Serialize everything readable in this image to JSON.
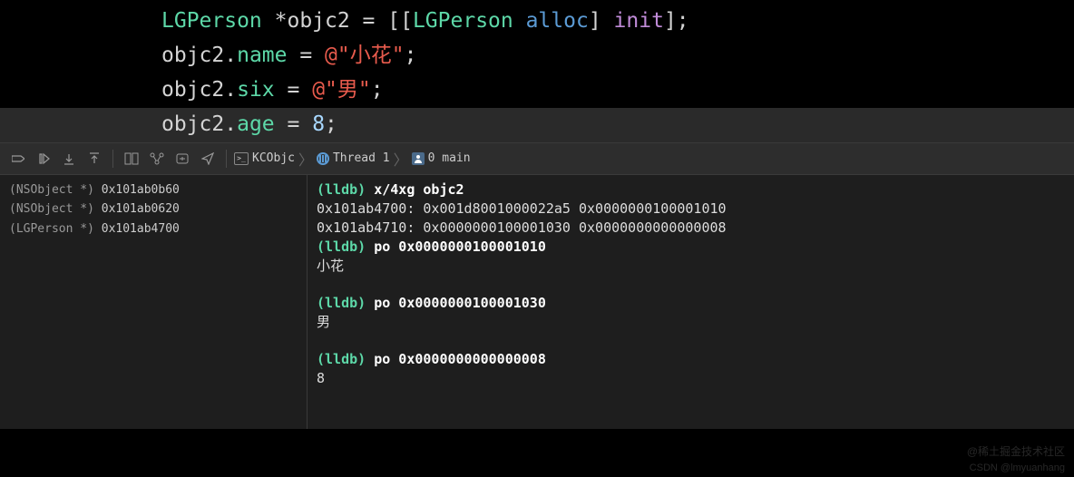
{
  "code": {
    "line1": {
      "type": "LGPerson",
      "var": " *objc2 = [[",
      "type2": "LGPerson",
      "alloc": " alloc",
      "bracket": "]",
      "init": " init",
      "end": "];"
    },
    "line2": {
      "var": "objc2.",
      "prop": "name",
      "eq": " = ",
      "str": "@\"小花\"",
      "end": ";"
    },
    "line3": {
      "var": "objc2.",
      "prop": "six",
      "eq": " = ",
      "str": "@\"男\"",
      "end": ";"
    },
    "line4": {
      "var": "objc2.",
      "prop": "age",
      "eq": " = ",
      "num": "8",
      "end": ";"
    }
  },
  "breadcrumb": {
    "app": "KCObjc",
    "thread": "Thread 1",
    "frame": "0 main"
  },
  "variables": [
    {
      "type": "(NSObject *)",
      "addr": "0x101ab0b60"
    },
    {
      "type": "(NSObject *)",
      "addr": "0x101ab0620"
    },
    {
      "type": "(LGPerson *)",
      "addr": "0x101ab4700"
    }
  ],
  "console": {
    "prompt": "(lldb)",
    "cmd1": "x/4xg objc2",
    "out1a": "0x101ab4700: 0x001d8001000022a5 0x0000000100001010",
    "out1b": "0x101ab4710: 0x0000000100001030 0x0000000000000008",
    "cmd2": "po 0x0000000100001010",
    "out2": "小花",
    "cmd3": "po 0x0000000100001030",
    "out3": "男",
    "cmd4": "po 0x0000000000000008",
    "out4": "8"
  },
  "watermark1": "@稀土掘金技术社区",
  "watermark2": "CSDN @lmyuanhang"
}
